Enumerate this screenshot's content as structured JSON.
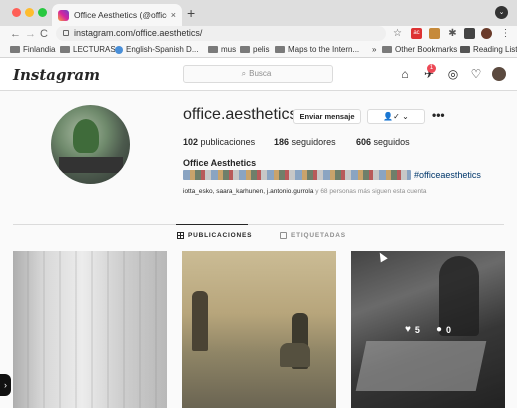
{
  "browser": {
    "tab_title": "Office Aesthetics (@office.ae",
    "tab_close": "×",
    "new_tab": "+",
    "url": "instagram.com/office.aesthetics/",
    "back": "←",
    "forward": "→",
    "reload": "C",
    "star": "☆",
    "ext_badge": "ac",
    "puzzle": "✱",
    "menu": "⋮",
    "window_menu": "⌄"
  },
  "bookmarks": {
    "items": [
      {
        "label": "Finlandia",
        "icon": "folder-icon"
      },
      {
        "label": "LECTURAS",
        "icon": "folder-icon"
      },
      {
        "label": "English-Spanish D...",
        "icon": "dictionary-icon"
      },
      {
        "label": "mus",
        "icon": "folder-icon"
      },
      {
        "label": "pelis",
        "icon": "folder-icon"
      },
      {
        "label": "Maps to the Intern...",
        "icon": "folder-icon"
      }
    ],
    "more": "»",
    "other": "Other Bookmarks",
    "reading_list": "Reading List"
  },
  "instagram": {
    "logo": "Instagram",
    "search_placeholder": "Busca",
    "search_icon": "⌕",
    "nav": {
      "home": "⌂",
      "direct": "✈",
      "explore": "◎",
      "activity": "♡",
      "notif_count": "1"
    }
  },
  "profile": {
    "username": "office.aesthetics",
    "message_button": "Enviar mensaje",
    "follow_button": "👤✓",
    "follow_chevron": "⌄",
    "more": "•••",
    "stats": {
      "posts_count": "102",
      "posts_label": "publicaciones",
      "followers_count": "186",
      "followers_label": "seguidores",
      "following_count": "606",
      "following_label": "seguidos"
    },
    "full_name": "Office Aesthetics",
    "bio_hashtag": "#officeaesthetics",
    "followed_by_names": "iotta_esko, saara_karhunen, j.antonio.gurrola",
    "followed_by_rest": " y 68 personas más siguen esta cuenta"
  },
  "tabs": {
    "posts": "PUBLICACIONES",
    "tagged": "ETIQUETADAS"
  },
  "posts": [
    {
      "id": "post-1"
    },
    {
      "id": "post-2"
    },
    {
      "id": "post-3",
      "likes": "5",
      "comments": "0"
    }
  ],
  "overlay": {
    "heart": "♥",
    "comment": "●"
  },
  "corner_glyph": "›"
}
